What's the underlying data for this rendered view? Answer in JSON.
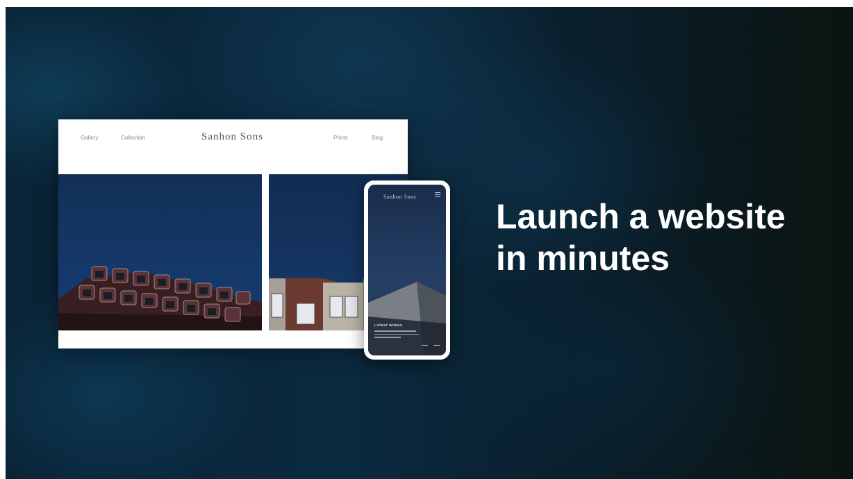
{
  "desktop": {
    "nav": {
      "left_links": [
        "Gallery",
        "Collection"
      ],
      "brand": "Sanhon Sons",
      "right_links": [
        "Prints",
        "Blog"
      ]
    }
  },
  "phone": {
    "brand": "Sanhon Sons",
    "menu_icon": "hamburger-menu-icon",
    "caption_title": "LATEST WORKS"
  },
  "headline": {
    "line1": "Launch a website",
    "line2": "in minutes"
  },
  "colors": {
    "background_dark": "#0b2a40",
    "headline_text": "#ffffff",
    "sky_blue": "#15386a"
  }
}
